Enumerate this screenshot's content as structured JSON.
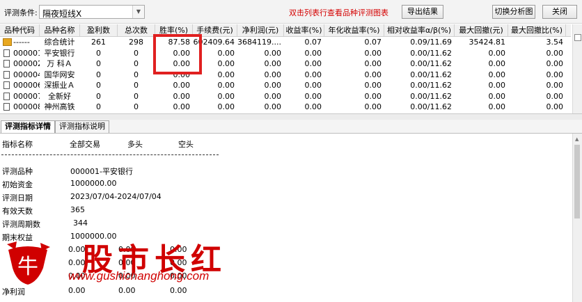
{
  "toolbar": {
    "condition_label": "评测条件:",
    "condition_value": "隔夜短线X",
    "hint": "双击列表行查看品种评测图表",
    "export_label": "导出结果",
    "switch_label": "切换分析图",
    "close_label": "关闭"
  },
  "table": {
    "headers": [
      "品种代码",
      "品种名称",
      "盈利数",
      "总次数",
      "胜率(%)",
      "手续费(元)",
      "净利润(元)",
      "收益率(%)",
      "年化收益率(%)",
      "相对收益率α/β(%)",
      "最大回撤(元)",
      "最大回撤比(%)"
    ],
    "rows": [
      [
        "------",
        "综合统计",
        "261",
        "298",
        "87.58",
        "602409.64",
        "3684119....",
        "0.07",
        "0.07",
        "0.09/11.69",
        "35424.81",
        "3.54"
      ],
      [
        "000001",
        "平安银行",
        "0",
        "0",
        "0.00",
        "0.00",
        "0.00",
        "0.00",
        "0.00",
        "0.00/11.62",
        "0.00",
        "0.00"
      ],
      [
        "000002",
        "万 科Ａ",
        "0",
        "0",
        "0.00",
        "0.00",
        "0.00",
        "0.00",
        "0.00",
        "0.00/11.62",
        "0.00",
        "0.00"
      ],
      [
        "000004",
        "国华网安",
        "0",
        "0",
        "0.00",
        "0.00",
        "0.00",
        "0.00",
        "0.00",
        "0.00/11.62",
        "0.00",
        "0.00"
      ],
      [
        "000006",
        "深振业Ａ",
        "0",
        "0",
        "0.00",
        "0.00",
        "0.00",
        "0.00",
        "0.00",
        "0.00/11.62",
        "0.00",
        "0.00"
      ],
      [
        "000007",
        "全新好",
        "0",
        "0",
        "0.00",
        "0.00",
        "0.00",
        "0.00",
        "0.00",
        "0.00/11.62",
        "0.00",
        "0.00"
      ],
      [
        "000008",
        "神州高铁",
        "0",
        "0",
        "0.00",
        "0.00",
        "0.00",
        "0.00",
        "0.00",
        "0.00/11.62",
        "0.00",
        "0.00"
      ]
    ]
  },
  "tabs": [
    "评测指标详情",
    "评测指标说明"
  ],
  "detail": {
    "columns": [
      "指标名称",
      "全部交易",
      "多头",
      "空头"
    ],
    "items": [
      [
        "评测品种",
        "000001-平安银行"
      ],
      [
        "初始资金",
        "1000000.00"
      ],
      [
        "评测日期",
        "2023/07/04-2024/07/04"
      ],
      [
        "有效天数",
        "365"
      ],
      [
        "评测周期数",
        "344"
      ],
      [
        "期末权益",
        "1000000.00"
      ],
      [
        "",
        "0.00",
        "0.00",
        "0.00"
      ],
      [
        "",
        "0.00",
        "0.00",
        "0.00"
      ],
      [
        "",
        "0.00",
        "0.00",
        "0.00"
      ],
      [
        "净利润",
        "0.00",
        "0.00",
        "0.00"
      ]
    ]
  },
  "watermark": {
    "brand": "股市长红",
    "url": "www.gushichanghong.com",
    "icon_glyph": "牛"
  },
  "colors": {
    "hint": "#d40000",
    "highlight_box": "#e02020",
    "watermark": "#d00000"
  }
}
